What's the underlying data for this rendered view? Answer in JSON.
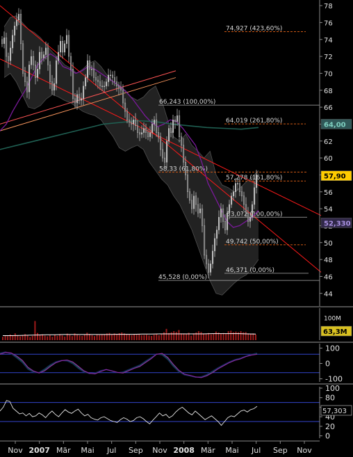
{
  "chart_data": [
    {
      "type": "candlestick",
      "panel": "price",
      "ylim": [
        42.5,
        78.5
      ],
      "y_ticks": [
        44,
        46,
        48,
        50,
        52,
        54,
        56,
        58,
        60,
        62,
        64,
        66,
        68,
        70,
        72,
        74,
        76,
        78
      ],
      "x_tick_labels": [
        "Nov",
        "2007",
        "Mär",
        "Mai",
        "Jul",
        "Sep",
        "Nov",
        "2008",
        "Mär",
        "Mai",
        "Jul",
        "Sep",
        "Nov"
      ],
      "x_ticks_bold": [
        "2007",
        "2008"
      ],
      "series": [
        {
          "name": "Close",
          "values": [
            73.5,
            74.2,
            72.0,
            71.5,
            73.0,
            74.5,
            75.6,
            76.3,
            77.0,
            73.5,
            70.0,
            69.0,
            67.8,
            71.0,
            72.0,
            71.0,
            69.5,
            70.5,
            72.5,
            71.8,
            72.2,
            73.0,
            71.0,
            69.0,
            68.0,
            68.8,
            71.5,
            72.5,
            73.8,
            72.5,
            73.5,
            74.5,
            72.0,
            70.5,
            67.0,
            66.5,
            67.5,
            66.8,
            67.0,
            68.5,
            69.5,
            71.5,
            70.5,
            70.5,
            69.5,
            69.2,
            69.0,
            68.5,
            68.5,
            68.5,
            69.0,
            69.8,
            69.8,
            69.5,
            69.0,
            68.5,
            68.2,
            68.0,
            66.5,
            65.5,
            64.5,
            64.2,
            64.0,
            64.5,
            63.8,
            63.0,
            62.8,
            63.0,
            63.5,
            63.0,
            62.5,
            63.0,
            64.0,
            64.5,
            63.0,
            62.5,
            61.0,
            60.0,
            59.5,
            62.0,
            63.5,
            63.0,
            64.5,
            64.3,
            65.0,
            62.5,
            61.5,
            59.5,
            58.0,
            56.0,
            55.0,
            54.0,
            55.5,
            54.5,
            53.5,
            54.0,
            52.0,
            48.5,
            47.5,
            46.5,
            47.5,
            49.0,
            50.5,
            51.5,
            53.0,
            54.0,
            52.5,
            51.5,
            53.5,
            54.5,
            55.5,
            56.0,
            57.0,
            57.0,
            56.0,
            55.5,
            54.5,
            53.5,
            52.5,
            53.0,
            54.5,
            56.5,
            58.0
          ]
        },
        {
          "name": "Bollinger Upper",
          "values": [
            75.5,
            76.6,
            76.8,
            76.0,
            75.2,
            74.8,
            74.2,
            73.3,
            72.5,
            71.8,
            71.0,
            70.6,
            70.0,
            70.5,
            71.2,
            71.5,
            70.8,
            69.8,
            69.0,
            68.5,
            68.0,
            67.2,
            66.8,
            67.2,
            68.0,
            68.5,
            66.8,
            64.5,
            62.5,
            62.0,
            62.8,
            61.5,
            60.8,
            60.0,
            60.8,
            58.0,
            56.8,
            56.5,
            56.0,
            56.5,
            57.2,
            57.8,
            58.5
          ]
        },
        {
          "name": "Bollinger Lower",
          "values": [
            69.5,
            70.0,
            69.0,
            67.5,
            66.0,
            65.8,
            66.2,
            67.0,
            67.5,
            67.2,
            66.8,
            66.5,
            66.0,
            65.5,
            65.2,
            65.0,
            64.5,
            63.5,
            62.5,
            61.2,
            60.8,
            61.2,
            61.5,
            61.0,
            59.5,
            58.5,
            57.5,
            56.8,
            55.5,
            54.5,
            53.0,
            51.5,
            49.5,
            47.5,
            45.5,
            44.0,
            43.8,
            44.5,
            45.2,
            45.8,
            46.2,
            47.0,
            48.0
          ]
        },
        {
          "name": "Moving Average 1",
          "values": [
            63.2,
            64.0,
            65.5,
            66.8,
            68.0,
            69.5,
            71.0,
            71.8,
            72.3,
            71.8,
            70.8,
            70.5,
            70.0,
            70.3,
            70.8,
            70.5,
            70.0,
            69.5,
            69.0,
            68.5,
            67.8,
            67.0,
            66.0,
            65.0,
            64.2,
            63.7,
            64.0,
            64.5,
            64.3,
            63.5,
            62.5,
            61.5,
            59.5,
            57.0,
            55.5,
            54.0,
            52.5,
            51.8,
            52.0,
            52.5,
            53.0,
            53.8
          ]
        },
        {
          "name": "Moving Average 2",
          "values": [
            61.0,
            61.5,
            62.0,
            62.5,
            63.0,
            63.5,
            64.0,
            64.2,
            64.4,
            64.3,
            64.0,
            63.8,
            63.6,
            63.5,
            63.4,
            63.6
          ]
        }
      ],
      "channel_lines": [
        {
          "name": "upper channel",
          "from": [
            "Okt 2006",
            78.0
          ],
          "to": [
            "Nov 2008",
            46.5
          ]
        },
        {
          "name": "lower channel",
          "from": [
            "Okt 2006",
            71.7
          ],
          "to": [
            "Nov 2008",
            53.2
          ]
        },
        {
          "name": "orange trend line",
          "from": [
            "Okt 2006",
            64.0
          ],
          "to": [
            "Jul 2007",
            70.3
          ]
        }
      ],
      "levels": [
        {
          "value": 74.927,
          "label": "74,927 (423,60%)"
        },
        {
          "value": 66.243,
          "label": "66,243 (100,00%)"
        },
        {
          "value": 64.019,
          "label": "64,019 (261,80%)"
        },
        {
          "value": 58.33,
          "label": "58,33 (61,80%)"
        },
        {
          "value": 57.278,
          "label": "57,278 (161,80%)"
        },
        {
          "value": 53.0,
          "label": "53,0?2 (100,00%)"
        },
        {
          "value": 49.742,
          "label": "49,742 (50,00%)"
        },
        {
          "value": 46.371,
          "label": "46,371 (0,00%)"
        },
        {
          "value": 45.528,
          "label": "45,528 (0,00%)"
        }
      ],
      "value_flags": [
        {
          "value": 64.0,
          "label": "64,00"
        },
        {
          "value": 57.9,
          "label": "57,90"
        },
        {
          "value": 52.33,
          "label": "52,330"
        }
      ],
      "colors": {
        "candle_up": "#c8c8c8",
        "candle_down": "#6a6a6a",
        "upper_bb_fill": "#222222",
        "channel": "#ff1a1a",
        "trendline": "#ff5555",
        "ma1": "#7a1a9a",
        "ma2": "#1f5f52",
        "level_dashed": "#d05a14",
        "flag_current": "#ffcc00",
        "flag_ma": "#305858",
        "flag_purple": "#302848"
      }
    },
    {
      "type": "bar",
      "panel": "volume",
      "ylabel_tick": "100M",
      "ylim": [
        0,
        130
      ],
      "value_flag": "63,3M",
      "values": [
        15,
        21,
        18,
        25,
        22,
        30,
        20,
        17,
        23,
        27,
        21,
        14,
        19,
        85,
        32,
        23,
        26,
        20,
        17,
        22,
        15,
        24,
        19,
        27,
        21,
        16,
        29,
        23,
        18,
        30,
        24,
        21,
        19,
        26,
        33,
        28,
        22,
        18,
        25,
        23,
        26,
        27,
        30,
        32,
        24,
        30,
        28,
        31,
        34,
        30,
        28,
        25,
        22,
        27,
        24,
        26,
        22,
        23,
        24,
        21,
        19,
        24,
        27,
        22,
        26,
        35,
        50,
        32,
        35,
        40,
        36,
        45,
        30,
        30,
        28,
        33,
        20,
        30,
        34,
        40,
        36,
        30,
        28,
        32,
        26,
        30,
        38,
        34,
        30,
        32,
        28,
        40,
        42,
        35,
        38,
        35,
        40,
        35,
        36,
        30,
        28,
        30,
        25
      ],
      "average_line": [
        20,
        20,
        21,
        22,
        23,
        24,
        24,
        25,
        25,
        25,
        25,
        25,
        25,
        26,
        26,
        26,
        27,
        27,
        28,
        28,
        28,
        28,
        28,
        28,
        29,
        29,
        29,
        29,
        28,
        27
      ],
      "colors": {
        "bars": "#a01a1a",
        "average": "#ffffff"
      }
    },
    {
      "type": "line",
      "panel": "oscillator_1",
      "ylim": [
        -120,
        120
      ],
      "y_ticks": [
        -100,
        0,
        100
      ],
      "y_tick_labels": [
        "-100",
        "0",
        "100"
      ],
      "reference_lines": [
        60,
        -60
      ],
      "series": [
        {
          "name": "line A",
          "values": [
            60,
            72,
            68,
            48,
            20,
            -25,
            -50,
            -62,
            -48,
            -20,
            5,
            18,
            22,
            10,
            -18,
            -48,
            -64,
            -68,
            -52,
            -40,
            -48,
            -58,
            -62,
            -48,
            -32,
            -20,
            5,
            30,
            60,
            65,
            40,
            -5,
            -45,
            -70,
            -78,
            -88,
            -92,
            -80,
            -60,
            -35,
            -15,
            5,
            20,
            30,
            45,
            55,
            60
          ]
        },
        {
          "name": "line B",
          "values": [
            68,
            75,
            62,
            35,
            5,
            -38,
            -58,
            -58,
            -35,
            -8,
            12,
            20,
            16,
            -2,
            -32,
            -56,
            -66,
            -62,
            -46,
            -40,
            -50,
            -60,
            -55,
            -40,
            -25,
            -10,
            15,
            38,
            62,
            55,
            25,
            -20,
            -55,
            -75,
            -82,
            -90,
            -86,
            -72,
            -50,
            -28,
            -8,
            10,
            25,
            35,
            48,
            60,
            68
          ]
        }
      ],
      "colors": {
        "line_a": "#8a2aa2",
        "line_b": "#102a5a",
        "fill": "#1e6a48",
        "reference": "#3344cc"
      }
    },
    {
      "type": "line",
      "panel": "oscillator_2",
      "ylim": [
        -5,
        100
      ],
      "y_ticks": [
        0,
        20,
        40,
        60,
        80,
        100
      ],
      "y_tick_labels": [
        "0",
        "20",
        "40",
        "",
        "80",
        "100"
      ],
      "reference_lines": [
        70,
        30
      ],
      "value_flag": "57,303",
      "values": [
        52,
        60,
        74,
        72,
        58,
        52,
        46,
        48,
        42,
        47,
        40,
        42,
        48,
        44,
        38,
        46,
        52,
        45,
        40,
        48,
        55,
        50,
        47,
        52,
        56,
        48,
        42,
        45,
        38,
        35,
        33,
        38,
        40,
        36,
        32,
        30,
        28,
        34,
        38,
        35,
        30,
        32,
        38,
        40,
        36,
        30,
        25,
        33,
        40,
        48,
        42,
        45,
        38,
        42,
        50,
        56,
        60,
        54,
        48,
        44,
        52,
        46,
        40,
        34,
        38,
        42,
        36,
        30,
        22,
        30,
        38,
        42,
        40,
        46,
        52,
        54,
        50,
        55,
        57,
        62
      ],
      "colors": {
        "line": "#e6e6e6",
        "reference": "#3344cc"
      }
    }
  ]
}
